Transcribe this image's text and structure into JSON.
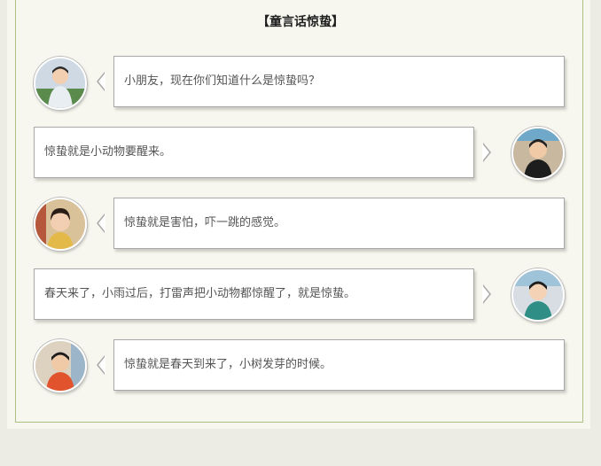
{
  "title": "【童言话惊蛰】",
  "messages": [
    {
      "side": "left",
      "text": "小朋友，现在你们知道什么是惊蛰吗？",
      "avatar_icon": "child-photo-avatar"
    },
    {
      "side": "right",
      "text": "惊蛰就是小动物要醒来。",
      "avatar_icon": "child-photo-avatar"
    },
    {
      "side": "left",
      "text": "惊蛰就是害怕，吓一跳的感觉。",
      "avatar_icon": "child-photo-avatar"
    },
    {
      "side": "right",
      "text": "春天来了，小雨过后，打雷声把小动物都惊醒了，就是惊蛰。",
      "avatar_icon": "child-photo-avatar"
    },
    {
      "side": "left",
      "text": "惊蛰就是春天到来了，小树发芽的时候。",
      "avatar_icon": "child-photo-avatar"
    }
  ],
  "colors": {
    "frame": "#a9c27f",
    "page": "#f7f7ef",
    "bubble_border": "#a8a8a8",
    "text": "#555555"
  }
}
